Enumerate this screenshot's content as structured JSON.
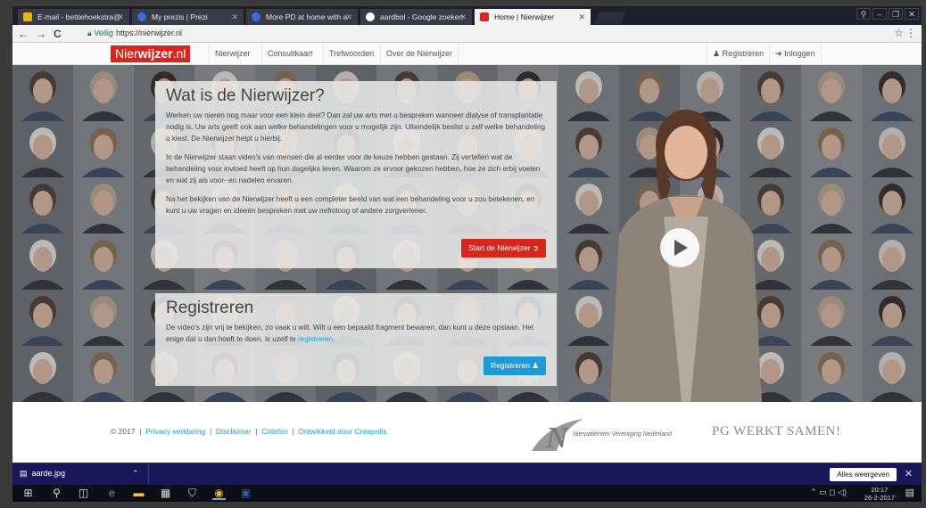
{
  "browser": {
    "tabs": [
      {
        "label": "E-mail - bettiehoekstra@",
        "favicon_color": "#e4b415"
      },
      {
        "label": "My prezis | Prezi",
        "favicon_color": "#3a6fd8"
      },
      {
        "label": "More PD at home with a",
        "favicon_color": "#3a6fd8"
      },
      {
        "label": "aardbol - Google zoeken",
        "favicon_color": "#ffffff"
      },
      {
        "label": "Home | Nierwijzer",
        "favicon_color": "#d7261e"
      }
    ],
    "secure_label": "Veilig",
    "url": "https://nierwijzer.nl"
  },
  "site": {
    "logo_prefix": "Nier",
    "logo_bold": "wijzer",
    "logo_suffix": ".nl",
    "nav": [
      "Nierwijzer",
      "Consultkaart",
      "Trefwoorden",
      "Over de Nierwijzer"
    ],
    "register_link": "Registreren",
    "login_link": "Inloggen"
  },
  "intro": {
    "title": "Wat is de Nierwijzer?",
    "p1": "Werken uw nieren nog maar voor een klein deel? Dan zal uw arts met u bespreken wanneer dialyse of transplantatie nodig is. Uw arts geeft ook aan welke behandelingen voor u mogelijk zijn. Uiteindelijk beslist u zelf welke behandeling u kiest. De Nierwijzer helpt u hierbij.",
    "p2": "In de Nierwijzer staan video's van mensen die al eerder voor de keuze hebben gestaan. Zij vertellen wat de behandeling voor invloed heeft op hun dagelijks leven. Waarom ze ervoor gekozen hebben, hoe ze zich erbij voelen en wat zij als voor- en nadelen ervaren.",
    "p3": "Na het bekijken van de Nierwijzer heeft u een completer beeld van wat een behandeling voor u zou betekenen, en kunt u uw vragen en ideeën bespreken met uw nefroloog of andere zorgverlener.",
    "button": "Start de Nierwijzer"
  },
  "register": {
    "title": "Registreren",
    "text": "De video's zijn vrij te bekijken, zo vaak u wilt. Wilt u een bepaald fragment bewaren, dan kunt u deze opslaan. Het enige dat u dan hoeft te doen, is uzelf te",
    "link": "registreren.",
    "button": "Registreren"
  },
  "footer": {
    "copyright": "© 2017",
    "links": [
      "Privacy verklaring",
      "Disclaimer",
      "Colofon",
      "Ontwikkeld door Creapolis"
    ],
    "nvn_text": "Nierpatiënten Vereniging Nederland",
    "pg_text": "PG WERKT SAMEN!"
  },
  "downloads": {
    "file": "aarde.jpg",
    "show_all": "Alles weergeven"
  },
  "taskbar": {
    "time": "20:17",
    "date": "26-2-2017"
  },
  "colors": {
    "brand_red": "#d7261e",
    "brand_blue": "#1f9ad6"
  }
}
